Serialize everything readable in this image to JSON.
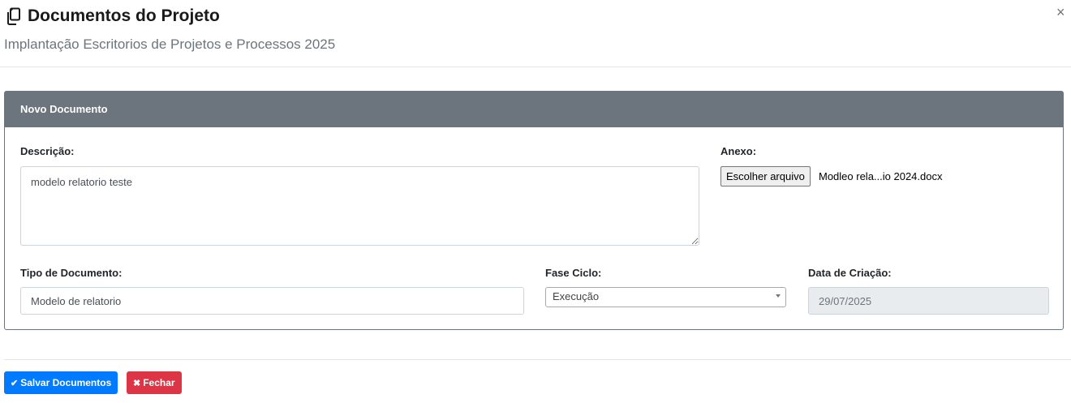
{
  "header": {
    "title": "Documentos do Projeto",
    "subtitle": "Implantação Escritorios de Projetos e Processos 2025",
    "close": "×"
  },
  "panel": {
    "title": "Novo Documento",
    "descricao": {
      "label": "Descrição:",
      "value": "modelo relatorio teste"
    },
    "anexo": {
      "label": "Anexo:",
      "button_label": "Escolher arquivo",
      "file_name": "Modleo rela...io 2024.docx"
    },
    "tipo": {
      "label": "Tipo de Documento:",
      "value": "Modelo de relatorio"
    },
    "fase": {
      "label": "Fase Ciclo:",
      "selected": "Execução"
    },
    "data": {
      "label": "Data de Criação:",
      "value": "29/07/2025"
    }
  },
  "footer": {
    "save_label": "Salvar Documentos",
    "close_label": "Fechar",
    "save_icon": "check-icon",
    "close_icon": "times-icon"
  },
  "colors": {
    "primary": "#007bff",
    "danger": "#dc3545",
    "panel_header": "#6c757d"
  }
}
